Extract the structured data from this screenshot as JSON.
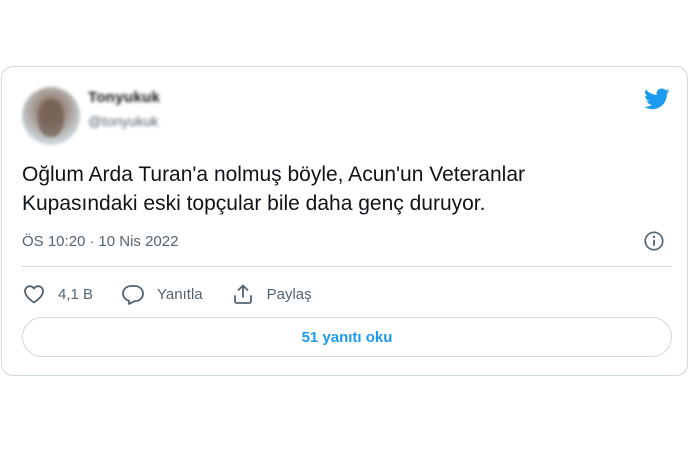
{
  "tweet": {
    "author_name": "Tonyukuk",
    "author_handle": "@tonyukuk",
    "text": "Oğlum Arda Turan'a nolmuş böyle, Acun'un Veteranlar\nKupasındaki eski topçular bile daha genç duruyor.",
    "time": "ÖS 10:20",
    "separator": "·",
    "date": "10 Nis 2022"
  },
  "actions": {
    "like_count": "4,1 B",
    "reply_label": "Yanıtla",
    "share_label": "Paylaş"
  },
  "replies_button": "51 yanıtı oku",
  "colors": {
    "brand": "#1d9bf0",
    "text": "#0f1419",
    "muted": "#536471",
    "border": "#cfd9de"
  },
  "icons": [
    "twitter-bird-icon",
    "info-icon",
    "heart-icon",
    "reply-bubble-icon",
    "share-icon"
  ]
}
